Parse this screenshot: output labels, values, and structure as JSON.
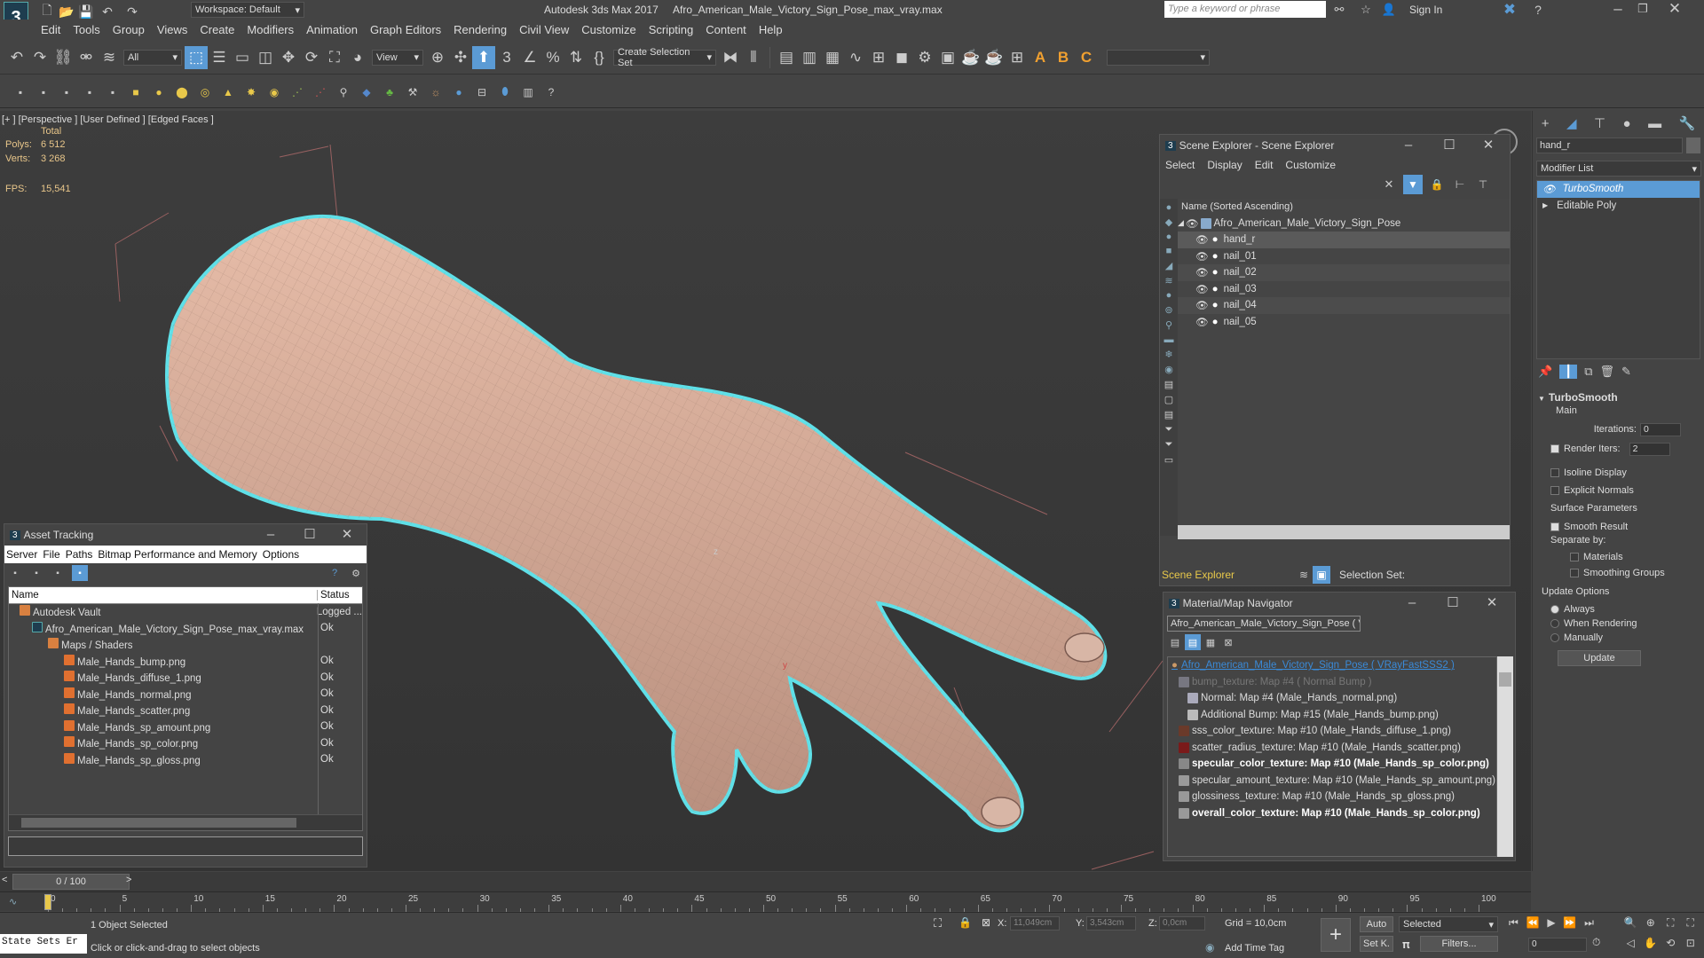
{
  "titlebar": {
    "workspace": "Workspace: Default",
    "app_title": "Autodesk 3ds Max 2017",
    "file_title": "Afro_American_Male_Victory_Sign_Pose_max_vray.max",
    "search_placeholder": "Type a keyword or phrase",
    "sign_in": "Sign In"
  },
  "menu": [
    "Edit",
    "Tools",
    "Group",
    "Views",
    "Create",
    "Modifiers",
    "Animation",
    "Graph Editors",
    "Rendering",
    "Civil View",
    "Customize",
    "Scripting",
    "Content",
    "Help"
  ],
  "toolbar": {
    "filter": "All",
    "ref_coord": "View",
    "selection_set": "Create Selection Set"
  },
  "viewport": {
    "label_plus": "[+ ]",
    "label_view": "[Perspective ]",
    "label_shading": "[User Defined ]",
    "label_edged": "[Edged Faces ]",
    "total": "Total",
    "polys_label": "Polys:",
    "polys": "6 512",
    "verts_label": "Verts:",
    "verts": "3 268",
    "fps_label": "FPS:",
    "fps": "15,541",
    "axis_z": "z",
    "axis_y": "y"
  },
  "scene_explorer": {
    "title": "Scene Explorer - Scene Explorer",
    "menus": [
      "Select",
      "Display",
      "Edit",
      "Customize"
    ],
    "column": "Name (Sorted Ascending)",
    "root": "Afro_American_Male_Victory_Sign_Pose",
    "items": [
      "hand_r",
      "nail_01",
      "nail_02",
      "nail_03",
      "nail_04",
      "nail_05"
    ],
    "footer_name": "Scene Explorer",
    "footer_sel": "Selection Set:"
  },
  "asset_tracking": {
    "title": "Asset Tracking",
    "menus": [
      "Server",
      "File",
      "Paths",
      "Bitmap Performance and Memory",
      "Options"
    ],
    "col_name": "Name",
    "col_status": "Status",
    "rows": [
      {
        "name": "Autodesk Vault",
        "status": "Logged ..."
      },
      {
        "name": "Afro_American_Male_Victory_Sign_Pose_max_vray.max",
        "status": "Ok"
      },
      {
        "name": "Maps / Shaders",
        "status": ""
      },
      {
        "name": "Male_Hands_bump.png",
        "status": "Ok"
      },
      {
        "name": "Male_Hands_diffuse_1.png",
        "status": "Ok"
      },
      {
        "name": "Male_Hands_normal.png",
        "status": "Ok"
      },
      {
        "name": "Male_Hands_scatter.png",
        "status": "Ok"
      },
      {
        "name": "Male_Hands_sp_amount.png",
        "status": "Ok"
      },
      {
        "name": "Male_Hands_sp_color.png",
        "status": "Ok"
      },
      {
        "name": "Male_Hands_sp_gloss.png",
        "status": "Ok"
      }
    ]
  },
  "material_nav": {
    "title": "Material/Map Navigator",
    "field": "Afro_American_Male_Victory_Sign_Pose  ( VR",
    "items": [
      "Afro_American_Male_Victory_Sign_Pose  ( VRayFastSSS2 )",
      "bump_texture: Map #4  ( Normal Bump )",
      "Normal: Map #4 (Male_Hands_normal.png)",
      "Additional Bump: Map #15 (Male_Hands_bump.png)",
      "sss_color_texture: Map #10 (Male_Hands_diffuse_1.png)",
      "scatter_radius_texture: Map #10 (Male_Hands_scatter.png)",
      "specular_color_texture: Map #10 (Male_Hands_sp_color.png)",
      "specular_amount_texture: Map #10 (Male_Hands_sp_amount.png)",
      "glossiness_texture: Map #10 (Male_Hands_sp_gloss.png)",
      "overall_color_texture: Map #10 (Male_Hands_sp_color.png)"
    ]
  },
  "command_panel": {
    "object_name": "hand_r",
    "modifier_list": "Modifier List",
    "stack": [
      "TurboSmooth",
      "Editable Poly"
    ],
    "rollout": "TurboSmooth",
    "main": "Main",
    "iterations_label": "Iterations:",
    "iterations": "0",
    "render_iters_label": "Render Iters:",
    "render_iters": "2",
    "isoline": "Isoline Display",
    "explicit": "Explicit Normals",
    "surface": "Surface Parameters",
    "smooth_result": "Smooth Result",
    "separate_by": "Separate by:",
    "materials": "Materials",
    "smoothing_groups": "Smoothing Groups",
    "update_options": "Update Options",
    "always": "Always",
    "when_rendering": "When Rendering",
    "manually": "Manually",
    "update_btn": "Update"
  },
  "timeline": {
    "frame": "0 / 100",
    "ticks": [
      "0",
      "5",
      "10",
      "15",
      "20",
      "25",
      "30",
      "35",
      "40",
      "45",
      "50",
      "55",
      "60",
      "65",
      "70",
      "75",
      "80",
      "85",
      "90",
      "95",
      "100"
    ],
    "progress": 0
  },
  "status": {
    "state_sets": "State Sets Er",
    "selected": "1 Object Selected",
    "prompt": "Click or click-and-drag to select objects",
    "x_label": "X:",
    "x": "11,049cm",
    "y_label": "Y:",
    "y": "3,543cm",
    "z_label": "Z:",
    "z": "0,0cm",
    "grid": "Grid = 10,0cm",
    "add_time_tag": "Add Time Tag",
    "auto": "Auto",
    "setk": "Set K.",
    "selected_dd": "Selected",
    "filters": "Filters...",
    "frame_field": "0"
  }
}
